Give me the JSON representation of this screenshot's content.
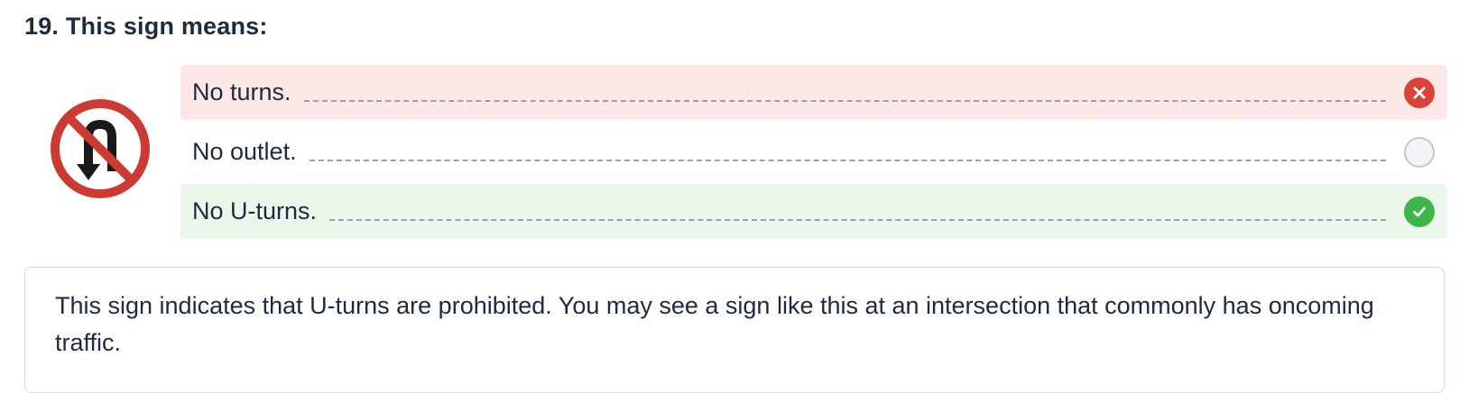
{
  "question": {
    "title": "19. This sign means:"
  },
  "sign": {
    "description_icon": "no-u-turn-sign-icon",
    "ring_color": "#cc3b33",
    "arrow_color": "#1a1a1a"
  },
  "answers": [
    {
      "label": "No turns.",
      "status": "incorrect",
      "icon": "close-icon"
    },
    {
      "label": "No outlet.",
      "status": "unselected",
      "icon": "empty-radio-icon"
    },
    {
      "label": "No U-turns.",
      "status": "correct",
      "icon": "check-icon"
    }
  ],
  "explanation": {
    "text": "This sign indicates that U-turns are prohibited. You may see a sign like this at an intersection that commonly has oncoming traffic."
  },
  "colors": {
    "incorrect_bg": "#fbe8e7",
    "correct_bg": "#eaf7ea",
    "incorrect_icon": "#d8443a",
    "correct_icon": "#3cb54a",
    "text": "#1f2a3c"
  }
}
